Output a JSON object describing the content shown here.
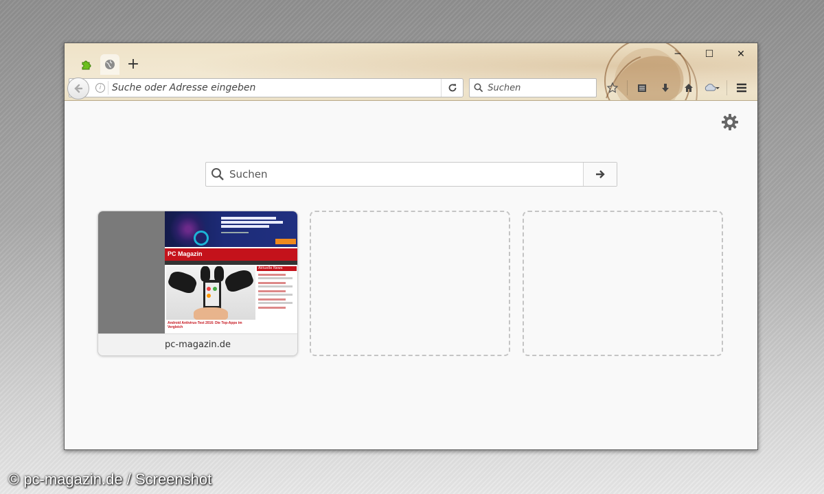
{
  "browser": {
    "tabs": [
      {
        "name": "addon-tab",
        "icon": "puzzle-icon"
      },
      {
        "name": "new-tab",
        "icon": "globe-icon",
        "active": true
      }
    ],
    "newtab_icon": "plus-icon",
    "window_controls": {
      "minimize": "─",
      "maximize": "☐",
      "close": "✕"
    },
    "urlbar": {
      "placeholder": "Suche oder Adresse eingeben"
    },
    "searchbar": {
      "placeholder": "Suchen"
    },
    "toolbar_icons": [
      "star-icon",
      "reading-list-icon",
      "download-icon",
      "home-icon",
      "sync-icon",
      "hamburger-menu-icon"
    ]
  },
  "newtab_page": {
    "search": {
      "placeholder": "Suchen"
    },
    "tiles": [
      {
        "label": "pc-magazin.de",
        "thumbnail": {
          "logo": "PC Magazin",
          "headline": "Android Antivirus-Test 2016: Die Top-Apps im Vergleich",
          "sidebar_title": "Aktuelle News"
        }
      },
      {
        "label": "",
        "empty": true
      },
      {
        "label": "",
        "empty": true
      }
    ]
  },
  "watermark": "© pc-magazin.de / Screenshot",
  "colors": {
    "accent_red": "#c4121b",
    "chrome": "#efe3c8"
  }
}
